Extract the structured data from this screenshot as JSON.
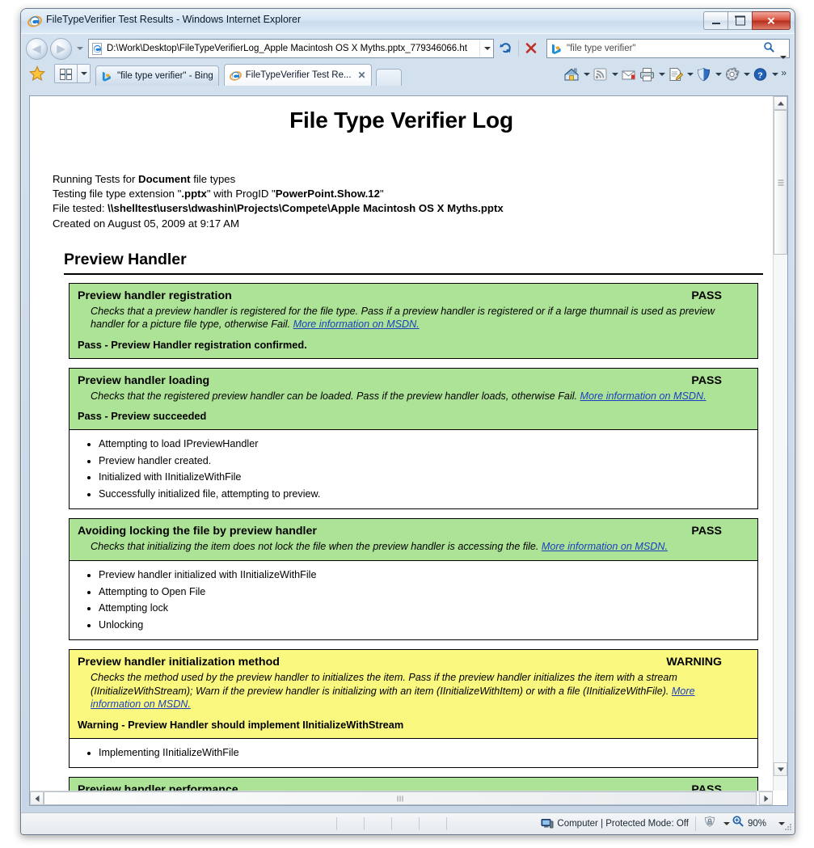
{
  "window": {
    "title": "FileTypeVerifier Test Results - Windows Internet Explorer",
    "minimize_label": "Minimize",
    "restore_label": "Restore",
    "close_label": "Close"
  },
  "nav": {
    "back_label": "Back",
    "forward_label": "Forward",
    "recent_pages_label": "Recent Pages",
    "address_value": "D:\\Work\\Desktop\\FileTypeVerifierLog_Apple Macintosh OS X Myths.pptx_779346066.ht",
    "refresh_label": "Refresh",
    "stop_label": "Stop",
    "search_value": "\"file type verifier\"",
    "search_placeholder": "Search"
  },
  "tabbar": {
    "favorites_label": "Favorites",
    "quick_tabs_label": "Quick Tabs",
    "tabs": [
      {
        "label": "\"file type verifier\" - Bing",
        "icon": "bing-icon",
        "active": false
      },
      {
        "label": "FileTypeVerifier Test Re...",
        "icon": "ie-icon",
        "active": true,
        "close": "✕"
      }
    ],
    "new_tab_label": "New Tab",
    "commands": [
      {
        "name": "home-icon",
        "label": "Home"
      },
      {
        "name": "feeds-icon",
        "label": "Feeds"
      },
      {
        "name": "mail-icon",
        "label": "Read Mail"
      },
      {
        "name": "print-icon",
        "label": "Print"
      },
      {
        "name": "page-icon",
        "label": "Page"
      },
      {
        "name": "safety-shield-icon",
        "label": "Safety"
      },
      {
        "name": "tools-gear-icon",
        "label": "Tools"
      },
      {
        "name": "help-icon",
        "label": "Help"
      }
    ],
    "overflow_label": "»"
  },
  "document": {
    "title": "File Type Verifier Log",
    "meta_lines": [
      {
        "pre": "Running Tests for ",
        "strong": "Document",
        "post": " file types"
      },
      {
        "pre": "Testing file type extension \"",
        "strong": ".pptx",
        "mid": "\" with ProgID \"",
        "strong2": "PowerPoint.Show.12",
        "post": "\""
      },
      {
        "pre": "File tested: ",
        "strong": "\\\\shelltest\\users\\dwashin\\Projects\\Compete\\Apple Macintosh OS X Myths.pptx",
        "post": ""
      },
      {
        "pre": "Created on August 05, 2009 at 9:17 AM",
        "strong": "",
        "post": ""
      }
    ],
    "section_heading": "Preview Handler",
    "link_text": "More information on MSDN.",
    "tests": [
      {
        "name": "Preview handler registration",
        "verdict": "PASS",
        "status": "pass",
        "description": "Checks that a preview handler is registered for the file type. Pass if a preview handler is registered or if a large thumnail is used as preview handler for a picture file type, otherwise Fail. ",
        "link": "More information on MSDN.",
        "result": "Pass - Preview Handler registration confirmed.",
        "log": []
      },
      {
        "name": "Preview handler loading",
        "verdict": "PASS",
        "status": "pass",
        "description": "Checks that the registered preview handler can be loaded. Pass if the preview handler loads, otherwise Fail. ",
        "link": "More information on MSDN.",
        "result": "Pass - Preview succeeded",
        "log": [
          "Attempting to load IPreviewHandler",
          "Preview handler created.",
          "Initialized with IInitializeWithFile",
          "Successfully initialized file, attempting to preview."
        ]
      },
      {
        "name": "Avoiding locking the file by preview handler",
        "verdict": "PASS",
        "status": "pass",
        "description": "Checks that initializing the item does not lock the file when the preview handler is accessing the file. ",
        "link": "More information on MSDN.",
        "result": "",
        "log": [
          "Preview handler initialized with IInitializeWithFile",
          "Attempting to Open File",
          "Attempting lock",
          "Unlocking"
        ]
      },
      {
        "name": "Preview handler initialization method",
        "verdict": "WARNING",
        "status": "warn",
        "description": "Checks the method used by the preview handler to initializes the item. Pass if the preview handler initializes the item with a stream (IInitializeWithStream); Warn if the preview handler is initializing with an item (IInitializeWithItem) or with a file (IInitializeWithFile). ",
        "link": "More information on MSDN.",
        "result": "Warning - Preview Handler should implement IInitializeWithStream",
        "log": [
          "Implementing IInitializeWithFile"
        ]
      },
      {
        "name": "Preview handler performance",
        "verdict": "PASS",
        "status": "pass",
        "description": "",
        "link": "",
        "result": "",
        "log": []
      }
    ]
  },
  "statusbar": {
    "zone_text": "Computer | Protected Mode: Off",
    "zoom_level": "90%"
  },
  "colors": {
    "pass_bg": "#ade396",
    "warn_bg": "#faf87f",
    "link": "#1c3fbf",
    "close_button": "#d9503c"
  }
}
